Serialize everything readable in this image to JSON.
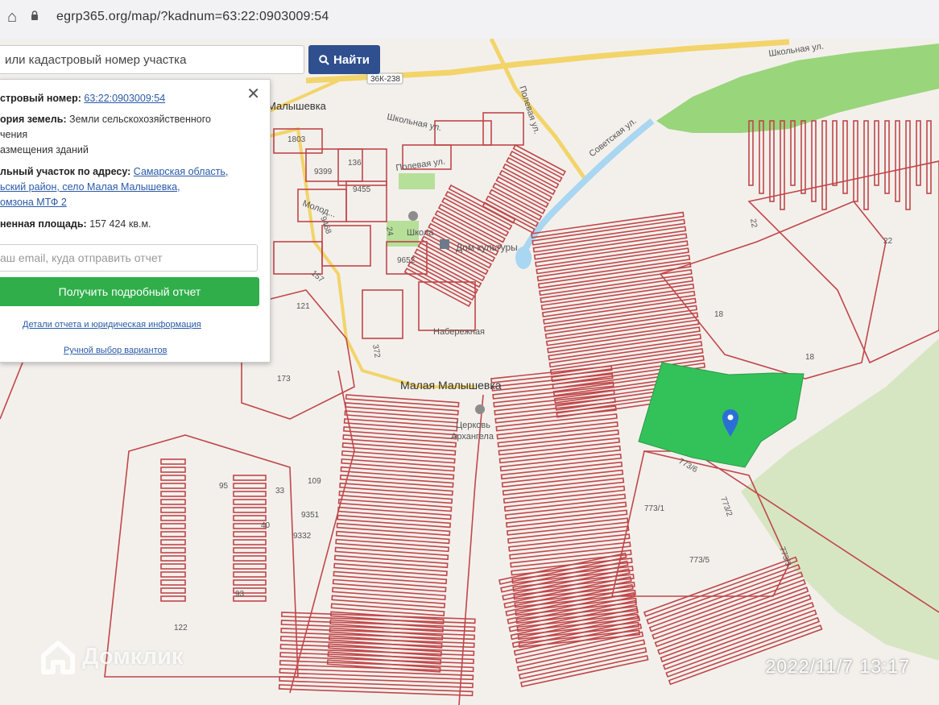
{
  "browser": {
    "url": "egrp365.org/map/?kadnum=63:22:0903009:54"
  },
  "search": {
    "placeholder": "или кадастровый номер участка",
    "button_label": "Найти"
  },
  "panel": {
    "cadastral_label": "стровый номер:",
    "cadastral_value": "63:22:0903009:54",
    "category_label": "ория земель:",
    "category_value_1": "Земли сельскохозяйственного",
    "category_value_2": "чения",
    "category_value_3": "азмещения зданий",
    "address_label": "льный участок по адресу:",
    "address_value_1": "Самарская область,",
    "address_value_2": "ьский район, село Малая Малышевка,",
    "address_value_3": "омзона МТФ 2",
    "area_label": "ненная площадь:",
    "area_value": "157 424 кв.м.",
    "email_placeholder": "аш email, куда отправить отчет",
    "report_button": "Получить подробный отчет",
    "details_link": "Детали отчета и юридическая информация",
    "manual_link": "Ручной выбор вариантов"
  },
  "map": {
    "road_badge": "36К-238",
    "villages": {
      "malysh_top": "Малышевка",
      "main": "Малая Малышевка"
    },
    "streets": {
      "shkolnaya_top": "Школьная ул.",
      "shkolnaya_mid": "Школьная ул.",
      "polevaya_1": "Полевая ул.",
      "polevaya_2": "Полевая ул.",
      "sovetskaya": "Советская ул.",
      "molod": "Молод..."
    },
    "pois": {
      "school": "Школа",
      "dom_kultury": "Дом культуры",
      "church_1": "Церковь",
      "church_2": "Архангела",
      "naberezh": "Набережная"
    },
    "parcels": {
      "p1803": "1803",
      "p136": "136",
      "p9399": "9399",
      "p9455": "9455",
      "p9468": "9468",
      "p24": "24",
      "p9652": "9652",
      "p157": "157",
      "p121": "121",
      "p173": "173",
      "p372": "372",
      "p18a": "18",
      "p18b": "18",
      "p22a": "22",
      "p22b": "22",
      "p773_6": "773/6",
      "p773_1": "773/1",
      "p773_2": "773/2",
      "p773_5": "773/5",
      "p773_3": "773/3",
      "p95": "95",
      "p33": "33",
      "p109": "109",
      "p9351": "9351",
      "p40": "40",
      "p9332": "9332",
      "p93": "93",
      "p122": "122"
    },
    "colors": {
      "boundary": "#c0474a",
      "highlight": "#33c25a",
      "park": "#8fd16e",
      "road": "#f2d46a",
      "water": "#a9d6f0",
      "marker": "#2a6fd6"
    }
  },
  "overlay": {
    "watermark": "Домклик",
    "timestamp": "2022/11/7  13:17"
  }
}
